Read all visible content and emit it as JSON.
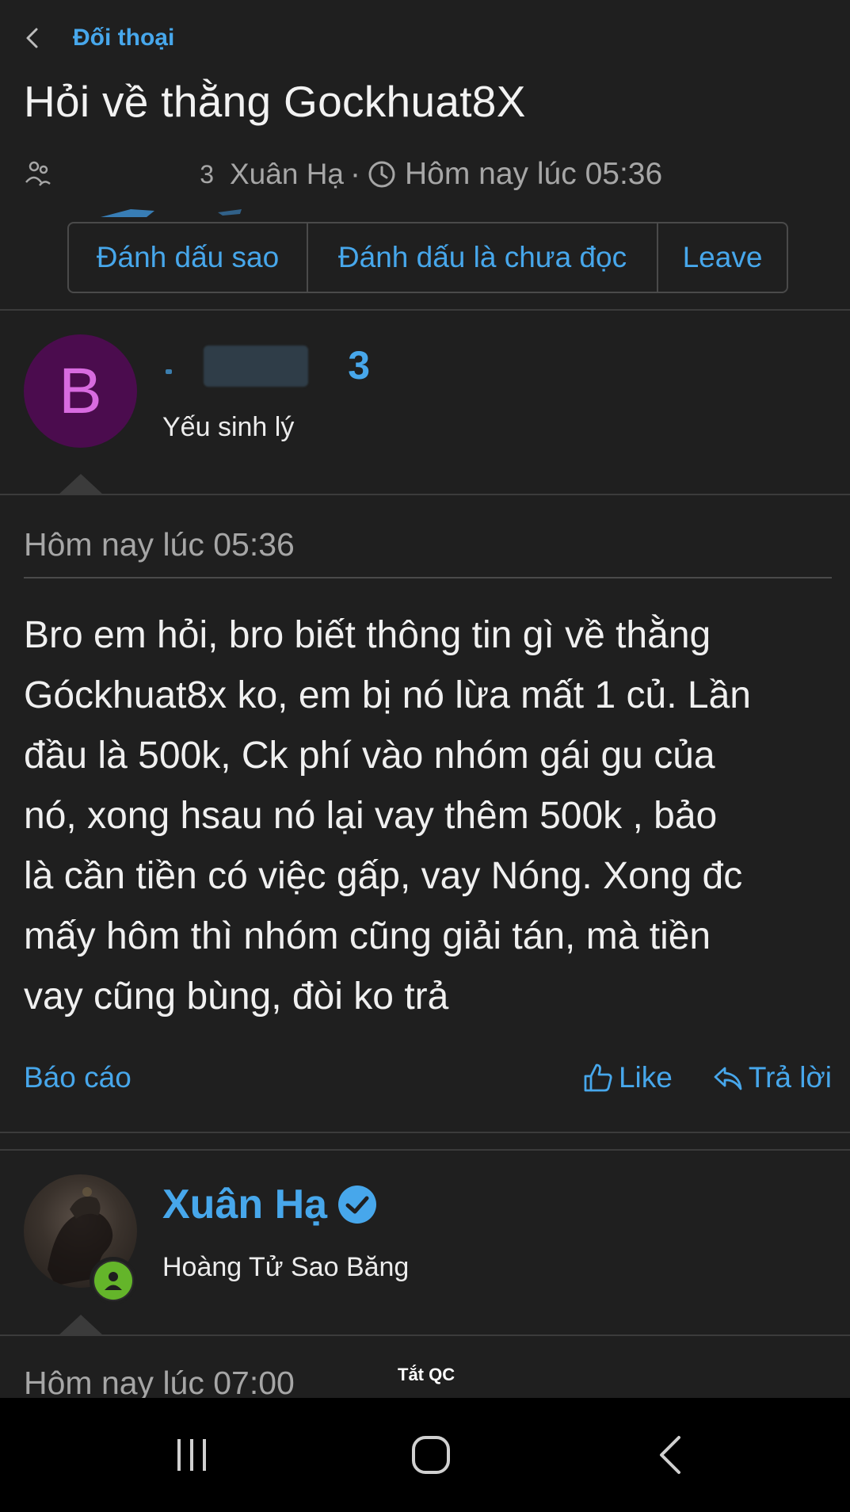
{
  "header": {
    "breadcrumb_label": "Đối thoại",
    "title": "Hỏi về thằng Gockhuat8X",
    "meta_partial_name_tail": "3",
    "meta_author": "Xuân Hạ",
    "meta_separator": "·",
    "meta_time": "Hôm nay lúc 05:36"
  },
  "toolbar": {
    "star_label": "Đánh dấu sao",
    "mark_unread_label": "Đánh dấu là chưa đọc",
    "leave_label": "Leave"
  },
  "message1": {
    "avatar_letter": "B",
    "username_tail": "3",
    "user_title": "Yếu sinh lý",
    "date": "Hôm nay lúc 05:36",
    "lines": [
      "Bro em hỏi, bro biết thông tin gì về thằng",
      "Góckhuat8x ko, em bị nó lừa mất 1 củ. Lần",
      "đầu là 500k, Ck phí vào nhóm gái gu của",
      "nó, xong hsau nó lại vay thêm 500k , bảo",
      "là cần tiền có việc gấp, vay Nóng. Xong đc",
      "mấy hôm thì nhóm cũng giải tán, mà tiền",
      "vay cũng bùng, đòi ko trả"
    ],
    "report_label": "Báo cáo",
    "like_label": "Like",
    "reply_label": "Trả lời"
  },
  "message2": {
    "username": "Xuân Hạ",
    "user_title": "Hoàng Tử Sao Băng",
    "date": "Hôm nay lúc 07:00"
  },
  "ad_toggle_label": "Tắt QC",
  "icons": {
    "back": "chevron-left-icon",
    "people": "people-icon",
    "clock": "clock-icon",
    "like": "thumbs-up-icon",
    "reply": "reply-icon",
    "verified": "verified-badge-icon",
    "online": "online-status-icon"
  },
  "colors": {
    "background": "#1f1f1f",
    "accent": "#47a7eb",
    "muted_text": "#a6a6a6",
    "avatar_letter_bg": "#4b0c4e",
    "avatar_letter_fg": "#d86be0",
    "online_green": "#64b52a"
  }
}
